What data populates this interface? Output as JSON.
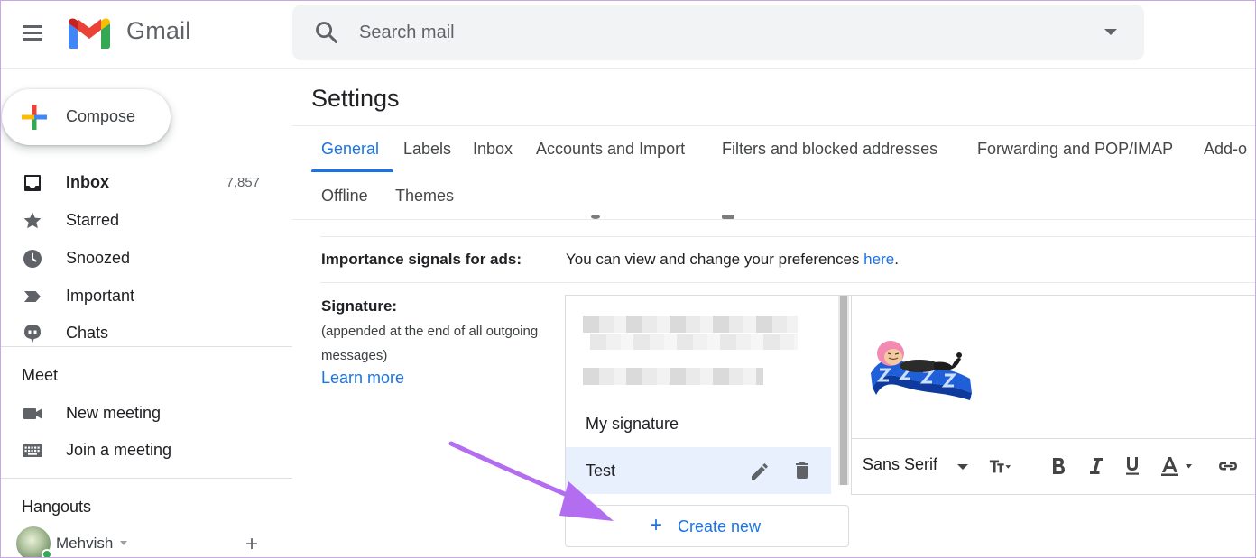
{
  "header": {
    "brand": "Gmail",
    "search_placeholder": "Search mail"
  },
  "sidebar": {
    "compose_label": "Compose",
    "items": [
      {
        "label": "Inbox",
        "count": "7,857",
        "icon": "inbox-icon"
      },
      {
        "label": "Starred",
        "icon": "star-icon"
      },
      {
        "label": "Snoozed",
        "icon": "clock-icon"
      },
      {
        "label": "Important",
        "icon": "label-important-icon"
      },
      {
        "label": "Chats",
        "icon": "chat-bubble-icon"
      }
    ],
    "meet": {
      "title": "Meet",
      "items": [
        {
          "label": "New meeting",
          "icon": "videocam-icon"
        },
        {
          "label": "Join a meeting",
          "icon": "keyboard-icon"
        }
      ]
    },
    "hangouts": {
      "title": "Hangouts",
      "user_name": "Mehvish"
    }
  },
  "main": {
    "title": "Settings",
    "tabs": [
      {
        "label": "General",
        "active": true
      },
      {
        "label": "Labels"
      },
      {
        "label": "Inbox"
      },
      {
        "label": "Accounts and Import"
      },
      {
        "label": "Filters and blocked addresses"
      },
      {
        "label": "Forwarding and POP/IMAP"
      },
      {
        "label": "Add-o"
      },
      {
        "label": "Offline"
      },
      {
        "label": "Themes"
      }
    ],
    "importance": {
      "label": "Importance signals for ads:",
      "text": "You can view and change your preferences ",
      "link": "here",
      "period": "."
    },
    "signature": {
      "label": "Signature:",
      "note": "(appended at the end of all outgoing messages)",
      "learn_more": "Learn more",
      "items": [
        {
          "label": "My signature"
        },
        {
          "label": "Test",
          "selected": true
        }
      ],
      "create_new": "Create new"
    },
    "editor": {
      "font": "Sans Serif"
    }
  },
  "colors": {
    "accent": "#1a73e8",
    "selected_bg": "#e8f0fe",
    "arrow": "#b36df0"
  }
}
